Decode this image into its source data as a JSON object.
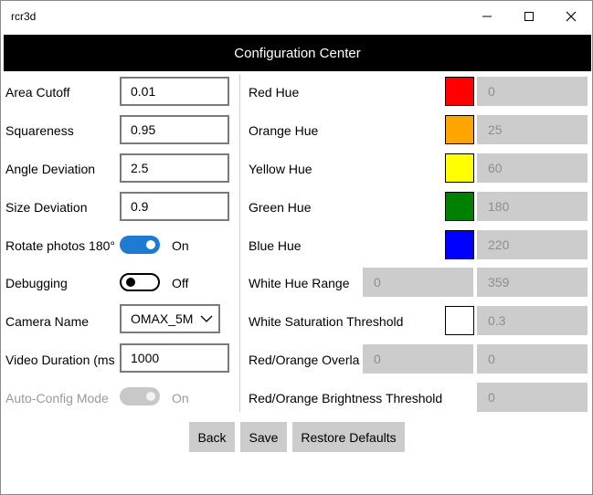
{
  "window": {
    "title": "rcr3d",
    "minimize_icon": "minimize-icon",
    "maximize_icon": "maximize-icon",
    "close_icon": "close-icon"
  },
  "header": {
    "title": "Configuration Center"
  },
  "left": {
    "area_cutoff": {
      "label": "Area Cutoff",
      "value": "0.01"
    },
    "squareness": {
      "label": "Squareness",
      "value": "0.95"
    },
    "angle_deviation": {
      "label": "Angle Deviation",
      "value": "2.5"
    },
    "size_deviation": {
      "label": "Size Deviation",
      "value": "0.9"
    },
    "rotate_photos": {
      "label": "Rotate photos 180°",
      "state": "On",
      "checked": true
    },
    "debugging": {
      "label": "Debugging",
      "state": "Off",
      "checked": false
    },
    "camera_name": {
      "label": "Camera Name",
      "value": "OMAX_5M"
    },
    "video_duration": {
      "label": "Video Duration (ms",
      "value": "1000"
    },
    "auto_config": {
      "label": "Auto-Config Mode",
      "state": "On",
      "checked": true,
      "enabled": false
    }
  },
  "right": {
    "red_hue": {
      "label": "Red Hue",
      "color": "#ff0000",
      "value": "0"
    },
    "orange_hue": {
      "label": "Orange Hue",
      "color": "#ffa500",
      "value": "25"
    },
    "yellow_hue": {
      "label": "Yellow Hue",
      "color": "#ffff00",
      "value": "60"
    },
    "green_hue": {
      "label": "Green Hue",
      "color": "#008000",
      "value": "180"
    },
    "blue_hue": {
      "label": "Blue Hue",
      "color": "#0000ff",
      "value": "220"
    },
    "white_hue_range": {
      "label": "White Hue Range",
      "min": "0",
      "max": "359"
    },
    "white_saturation": {
      "label": "White Saturation Threshold",
      "color": "#ffffff",
      "value": "0.3"
    },
    "red_orange_overlap": {
      "label": "Red/Orange Overla",
      "min": "0",
      "max": "0"
    },
    "red_orange_brightness": {
      "label": "Red/Orange Brightness Threshold",
      "value": "0"
    }
  },
  "buttons": {
    "back": "Back",
    "save": "Save",
    "restore": "Restore Defaults"
  },
  "colors": {
    "accent": "#1f7ad1",
    "header_bg": "#000000",
    "disabled_bg": "#cccccc"
  }
}
